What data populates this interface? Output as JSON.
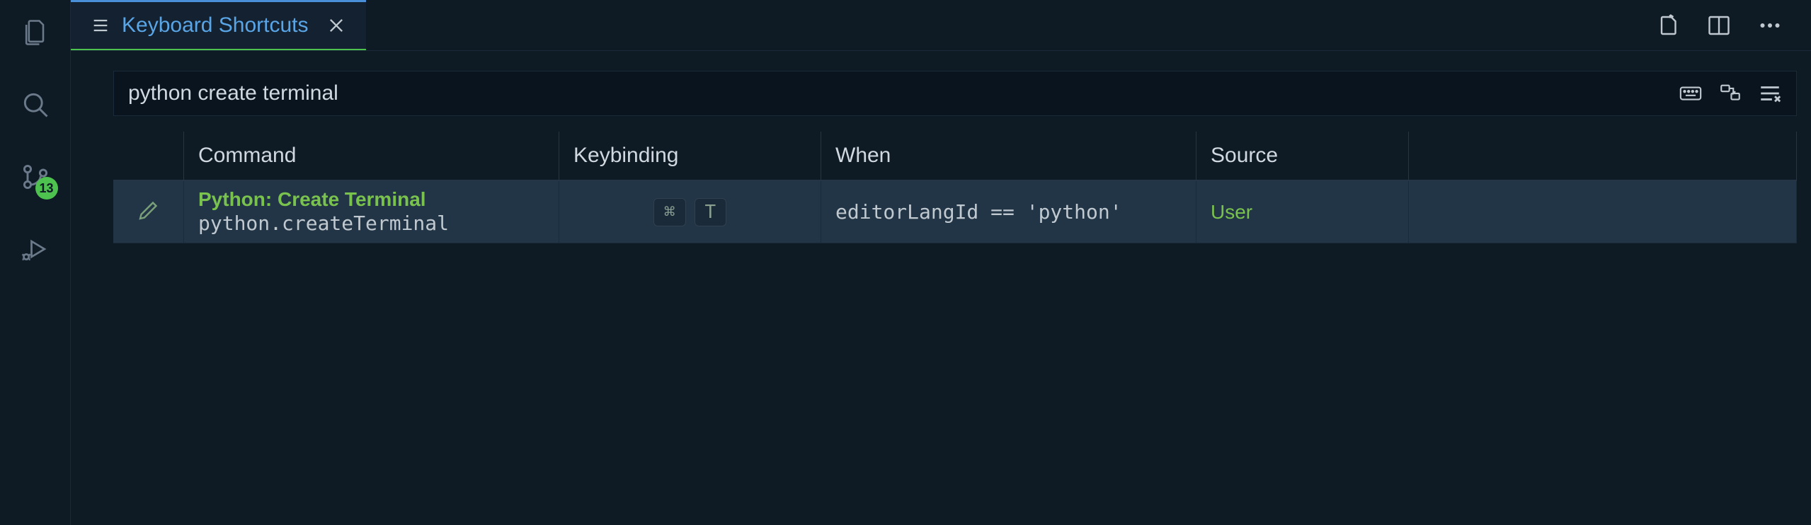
{
  "tab": {
    "label": "Keyboard Shortcuts"
  },
  "search": {
    "value": "python create terminal"
  },
  "columns": {
    "command": "Command",
    "keybinding": "Keybinding",
    "when": "When",
    "source": "Source"
  },
  "activityBar": {
    "scmBadge": "13"
  },
  "rows": [
    {
      "title": "Python: Create Terminal",
      "id": "python.createTerminal",
      "keys": [
        "⌘",
        "T"
      ],
      "when": "editorLangId == 'python'",
      "source": "User"
    }
  ]
}
